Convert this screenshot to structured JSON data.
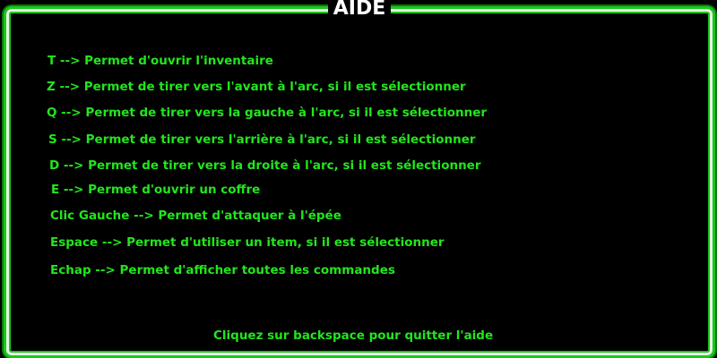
{
  "title": "AIDE",
  "commands": [
    "T --> Permet d'ouvrir l'inventaire",
    "Z --> Permet de tirer vers l'avant à l'arc, si il est sélectionner",
    "Q --> Permet de tirer vers la gauche à l'arc, si il est sélectionner",
    "S --> Permet de tirer vers l'arrière à l'arc, si il est sélectionner",
    "D --> Permet de tirer vers la droite à l'arc, si il est sélectionner",
    "E --> Permet d'ouvrir un coffre",
    "Clic Gauche --> Permet d'attaquer à l'épée",
    "Espace --> Permet d'utiliser un item, si il est sélectionner",
    "Echap --> Permet d'afficher toutes les commandes"
  ],
  "footer": "Cliquez sur backspace pour quitter l'aide",
  "colors": {
    "text": "#22e61c",
    "border": "#19c919",
    "title": "#ffffff"
  }
}
